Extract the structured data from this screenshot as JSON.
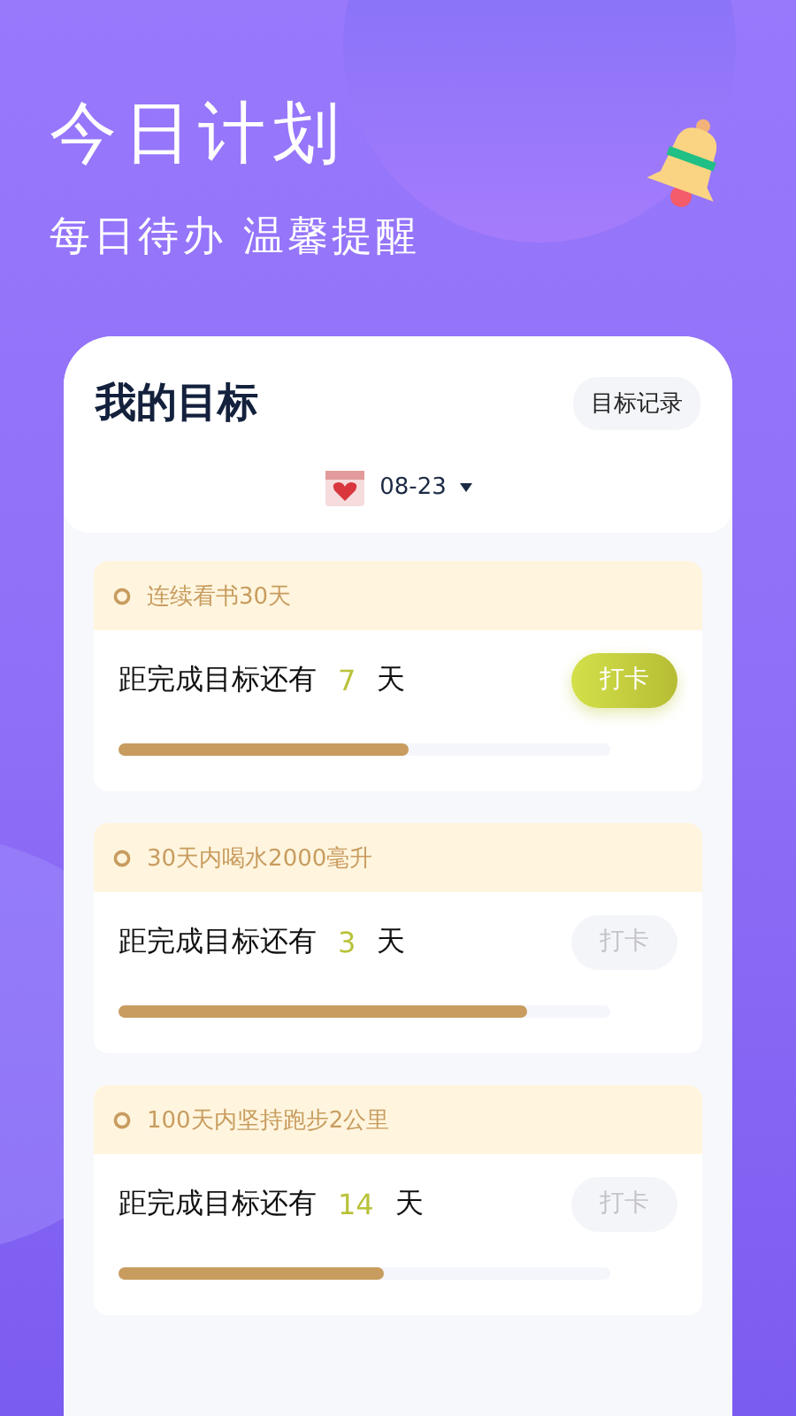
{
  "header": {
    "title": "今日计划",
    "subtitle": "每日待办 温馨提醒"
  },
  "panel": {
    "title": "我的目标",
    "record_button": "目标记录",
    "date": "08-23"
  },
  "goals": [
    {
      "name": "连续看书30天",
      "prefix": "距完成目标还有",
      "days": "7",
      "unit": "天",
      "level": 0.59,
      "button": "打卡",
      "disabled": false
    },
    {
      "name": "30天内喝水2000毫升",
      "prefix": "距完成目标还有",
      "days": "3",
      "unit": "天",
      "level": 0.83,
      "button": "打卡",
      "disabled": true
    },
    {
      "name": "100天内坚持跑步2公里",
      "prefix": "距完成目标还有",
      "days": "14",
      "unit": "天",
      "level": 0.54,
      "button": "打卡",
      "disabled": true
    }
  ]
}
